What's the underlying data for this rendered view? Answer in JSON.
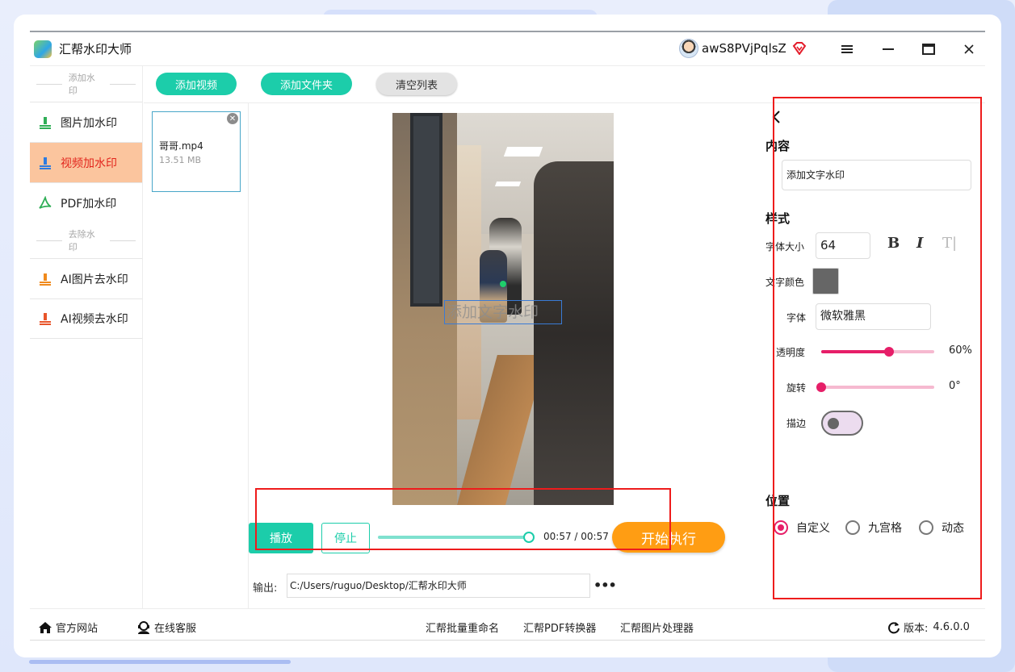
{
  "app": {
    "title": "汇帮水印大师",
    "user_name": "awS8PVjPqlsZ"
  },
  "sidebar": {
    "section_add": "添加水印",
    "section_remove": "去除水印",
    "items": [
      {
        "label": "图片加水印",
        "icon": "image-watermark-icon",
        "color": "#2fae56"
      },
      {
        "label": "视频加水印",
        "icon": "video-watermark-icon",
        "color": "#2d7be0",
        "active": true
      },
      {
        "label": "PDF加水印",
        "icon": "pdf-icon",
        "color": "#2fae56"
      },
      {
        "label": "AI图片去水印",
        "icon": "image-remove-icon",
        "color": "#f08a1c"
      },
      {
        "label": "AI视频去水印",
        "icon": "video-remove-icon",
        "color": "#e8552a"
      }
    ]
  },
  "toolbar": {
    "add_video": "添加视频",
    "add_folder": "添加文件夹",
    "clear_list": "清空列表"
  },
  "files": [
    {
      "name": "哥哥.mp4",
      "size": "13.51 MB"
    }
  ],
  "preview": {
    "watermark_text": "添加文字水印"
  },
  "playback": {
    "play": "播放",
    "stop": "停止",
    "time": "00:57 / 00:57",
    "progress": 1.0,
    "start": "开始执行"
  },
  "output": {
    "label": "输出:",
    "path": "C:/Users/ruguo/Desktop/汇帮水印大师",
    "more": "•••"
  },
  "panel": {
    "content_title": "内容",
    "content_value": "添加文字水印",
    "style_title": "样式",
    "font_size_label": "字体大小",
    "font_size": "64",
    "bold": "B",
    "italic": "I",
    "text_format": "T|",
    "text_color_label": "文字颜色",
    "text_color": "#666666",
    "font_label": "字体",
    "font_value": "微软雅黑",
    "opacity_label": "透明度",
    "opacity_value": "60%",
    "opacity": 0.6,
    "rotation_label": "旋转",
    "rotation_value": "0°",
    "rotation": 0,
    "stroke_label": "描边",
    "stroke_on": false,
    "position_title": "位置",
    "position_options": [
      "自定义",
      "九宫格",
      "动态"
    ],
    "position_selected": 0
  },
  "footer": {
    "website": "官方网站",
    "support": "在线客服",
    "links": [
      "汇帮批量重命名",
      "汇帮PDF转换器",
      "汇帮图片处理器"
    ],
    "version_label": "版本:",
    "version": "4.6.0.0"
  },
  "colors": {
    "accent_teal": "#1ccdaa",
    "accent_orange": "#ff9d13",
    "accent_pink": "#e61e68",
    "active_bg": "#fbc59e",
    "active_text": "#e2261d"
  }
}
